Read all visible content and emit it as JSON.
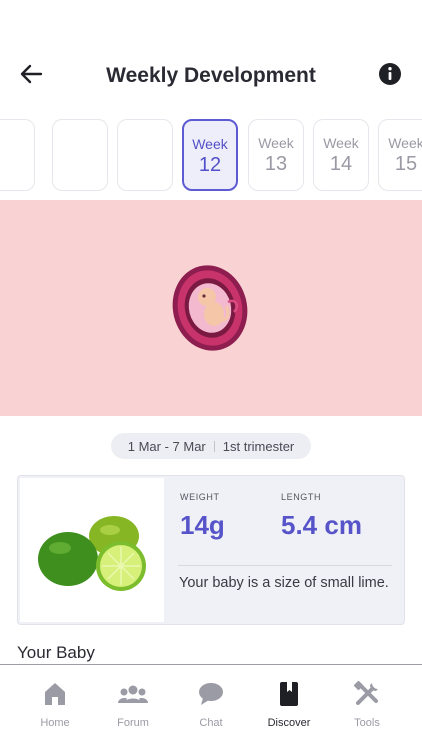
{
  "header": {
    "title": "Weekly Development",
    "back_icon": "arrow-left-icon",
    "info_icon": "info-icon"
  },
  "weeks": [
    {
      "label": "",
      "number": ""
    },
    {
      "label": "",
      "number": ""
    },
    {
      "label": "",
      "number": ""
    },
    {
      "label": "Week",
      "number": "12",
      "selected": true
    },
    {
      "label": "Week",
      "number": "13"
    },
    {
      "label": "Week",
      "number": "14"
    },
    {
      "label": "Week",
      "number": "15"
    }
  ],
  "hero": {
    "background": "#f9d3d3",
    "illustration": "embryo-illustration"
  },
  "date_range": {
    "dates": "1 Mar - 7 Mar",
    "trimester": "1st trimester"
  },
  "size_card": {
    "fruit_image": "lime-fruit-image",
    "weight_label": "WEIGHT",
    "weight_value": "14g",
    "length_label": "LENGTH",
    "length_value": "5.4 cm",
    "comparison": "Your baby is a size of small lime."
  },
  "section": {
    "title": "Your Baby"
  },
  "bottom_nav": [
    {
      "label": "Home",
      "icon": "home-icon"
    },
    {
      "label": "Forum",
      "icon": "people-icon"
    },
    {
      "label": "Chat",
      "icon": "chat-bubble-icon"
    },
    {
      "label": "Discover",
      "icon": "book-icon",
      "active": true
    },
    {
      "label": "Tools",
      "icon": "tools-icon"
    }
  ],
  "colors": {
    "accent": "#5654c8",
    "hero_bg": "#f9d3d3",
    "card_bg": "#f0f0f7"
  }
}
